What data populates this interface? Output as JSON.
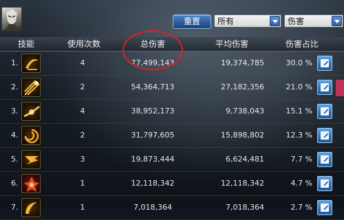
{
  "toolbar": {
    "reset_label": "重置",
    "filter_value": "所有",
    "metric_value": "伤害"
  },
  "table": {
    "headers": {
      "skill": "技能",
      "uses": "使用次数",
      "total": "总伤害",
      "avg": "平均伤害",
      "pct": "伤害占比"
    },
    "rows": [
      {
        "num": "1.",
        "uses": "4",
        "total": "77,499,143",
        "avg": "19,374,785",
        "pct": "30.0 %"
      },
      {
        "num": "2.",
        "uses": "2",
        "total": "54,364,713",
        "avg": "27,182,356",
        "pct": "21.0 %"
      },
      {
        "num": "3.",
        "uses": "4",
        "total": "38,952,173",
        "avg": "9,738,043",
        "pct": "15.1 %"
      },
      {
        "num": "4.",
        "uses": "2",
        "total": "31,797,605",
        "avg": "15,898,802",
        "pct": "12.3 %"
      },
      {
        "num": "5.",
        "uses": "3",
        "total": "19,873,444",
        "avg": "6,624,481",
        "pct": "7.7 %"
      },
      {
        "num": "6.",
        "uses": "1",
        "total": "12,118,342",
        "avg": "12,118,342",
        "pct": "4.7 %"
      },
      {
        "num": "7.",
        "uses": "1",
        "total": "7,018,364",
        "avg": "7,018,364",
        "pct": "2.7 %"
      }
    ]
  },
  "icons": {
    "avatar": "character-portrait",
    "skill_icons": [
      "crescent-slash-icon",
      "sword-burst-icon",
      "light-slash-icon",
      "vortex-icon",
      "wind-blade-icon",
      "flame-crest-icon",
      "arc-wave-icon"
    ],
    "share": "export-icon"
  },
  "colors": {
    "accent_blue": "#2f6fb6",
    "highlight_circle": "#e02020",
    "skill_gold": "#e0a020"
  }
}
